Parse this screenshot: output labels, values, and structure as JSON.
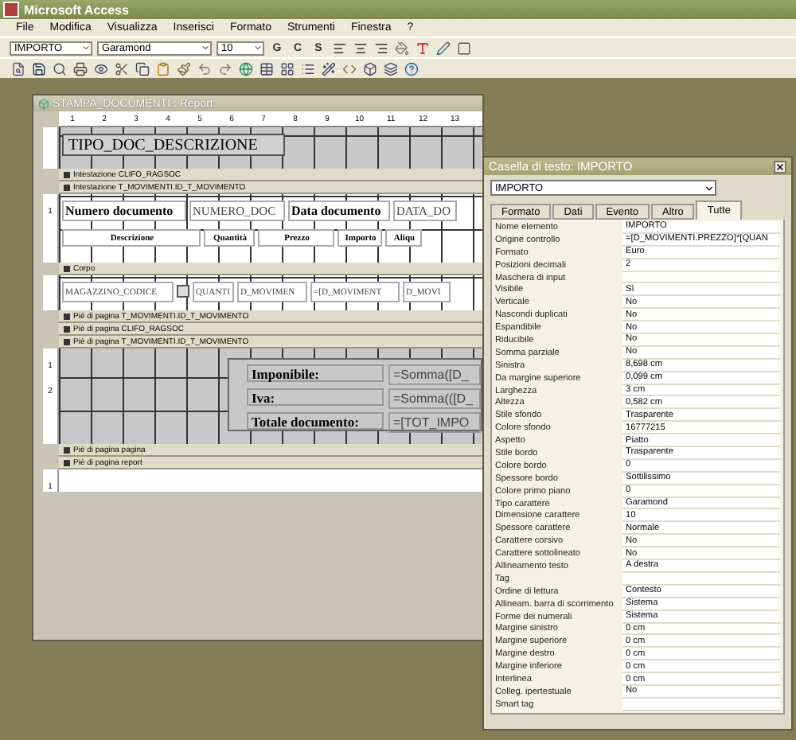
{
  "window": {
    "title": "Microsoft Access"
  },
  "menu": [
    "File",
    "Modifica",
    "Visualizza",
    "Inserisci",
    "Formato",
    "Strumenti",
    "Finestra",
    "?"
  ],
  "format_toolbar": {
    "object": "IMPORTO",
    "font": "Garamond",
    "size": "10",
    "style_buttons": [
      "G",
      "C",
      "S"
    ]
  },
  "report": {
    "title": "STAMPA_DOCUMENTI : Report",
    "ruler": [
      "1",
      "2",
      "3",
      "4",
      "5",
      "6",
      "7",
      "8",
      "9",
      "10",
      "11",
      "12",
      "13"
    ],
    "sections": [
      {
        "kind": "page_header",
        "title": "TIPO_DOC_DESCRIZIONE"
      },
      {
        "kind": "band",
        "label": "Intestazione CLIFO_RAGSOC"
      },
      {
        "kind": "band",
        "label": "Intestazione T_MOVIMENTI.ID_T_MOVIMENTO"
      },
      {
        "kind": "group_header",
        "v_ruler": [
          "1"
        ],
        "controls": [
          {
            "kind": "label",
            "text": "Numero documento"
          },
          {
            "kind": "field",
            "text": "NUMERO_DOC"
          },
          {
            "kind": "label",
            "text": "Data documento"
          },
          {
            "kind": "field",
            "text": "DATA_DO"
          }
        ],
        "captions": [
          "Descrizione",
          "Quantità",
          "Prezzo",
          "Importo",
          "Aliqu"
        ]
      },
      {
        "kind": "band",
        "label": "Corpo"
      },
      {
        "kind": "detail",
        "cells": [
          {
            "kind": "field",
            "text": "MAGAZZINO_CODICE"
          },
          {
            "kind": "combo"
          },
          {
            "kind": "field",
            "text": "QUANTI"
          },
          {
            "kind": "field",
            "text": "D_MOVIMEN"
          },
          {
            "kind": "field",
            "text": "=[D_MOVIMENT"
          },
          {
            "kind": "field",
            "text": "D_MOVI"
          }
        ]
      },
      {
        "kind": "band",
        "label": "Piè di pagina T_MOVIMENTI.ID_T_MOVIMENTO"
      },
      {
        "kind": "band",
        "label": "Piè di pagina CLIFO_RAGSOC"
      },
      {
        "kind": "band",
        "label": "Piè di pagina T_MOVIMENTI.ID_T_MOVIMENTO"
      },
      {
        "kind": "totals",
        "v_ruler": [
          "1",
          "2"
        ],
        "rows": [
          {
            "label": "Imponibile:",
            "value": "=Somma([D_"
          },
          {
            "label": "Iva:",
            "value": "=Somma(([D_"
          },
          {
            "label": "Totale documento:",
            "value": "=[TOT_IMPO"
          }
        ]
      },
      {
        "kind": "band",
        "label": "Piè di pagina pagina"
      },
      {
        "kind": "band",
        "label": "Piè di pagina report"
      },
      {
        "kind": "blank",
        "v_ruler": [
          "1"
        ]
      }
    ]
  },
  "sheet": {
    "title": "Casella di testo: IMPORTO",
    "object": "IMPORTO",
    "tabs": [
      {
        "label": "Formato",
        "selected": false
      },
      {
        "label": "Dati",
        "selected": false
      },
      {
        "label": "Evento",
        "selected": false
      },
      {
        "label": "Altro",
        "selected": false
      },
      {
        "label": "Tutte",
        "selected": true
      }
    ],
    "properties": [
      {
        "name": "Nome elemento",
        "value": "IMPORTO"
      },
      {
        "name": "Origine controllo",
        "value": "=[D_MOVIMENTI.PREZZO]*[QUAN"
      },
      {
        "name": "Formato",
        "value": "Euro"
      },
      {
        "name": "Posizioni decimali",
        "value": "2"
      },
      {
        "name": "Maschera di input"
      },
      {
        "name": "Visibile",
        "value": "Sì"
      },
      {
        "name": "Verticale",
        "value": "No"
      },
      {
        "name": "Nascondi duplicati",
        "value": "No"
      },
      {
        "name": "Espandibile",
        "value": "No"
      },
      {
        "name": "Riducibile",
        "value": "No"
      },
      {
        "name": "Somma parziale",
        "value": "No"
      },
      {
        "name": "Sinistra",
        "value": "8,698 cm"
      },
      {
        "name": "Da margine superiore",
        "value": "0,099 cm"
      },
      {
        "name": "Larghezza",
        "value": "3 cm"
      },
      {
        "name": "Altezza",
        "value": "0,582 cm"
      },
      {
        "name": "Stile sfondo",
        "value": "Trasparente"
      },
      {
        "name": "Colore sfondo",
        "value": "16777215"
      },
      {
        "name": "Aspetto",
        "value": "Piatto"
      },
      {
        "name": "Stile bordo",
        "value": "Trasparente"
      },
      {
        "name": "Colore bordo",
        "value": "0"
      },
      {
        "name": "Spessore bordo",
        "value": "Sottilissimo"
      },
      {
        "name": "Colore primo piano",
        "value": "0"
      },
      {
        "name": "Tipo carattere",
        "value": "Garamond"
      },
      {
        "name": "Dimensione carattere",
        "value": "10"
      },
      {
        "name": "Spessore carattere",
        "value": "Normale"
      },
      {
        "name": "Carattere corsivo",
        "value": "No"
      },
      {
        "name": "Carattere sottolineato",
        "value": "No"
      },
      {
        "name": "Allineamento testo",
        "value": "A destra"
      },
      {
        "name": "Tag"
      },
      {
        "name": "Ordine di lettura",
        "value": "Contesto"
      },
      {
        "name": "Allineam. barra di scorrimento",
        "value": "Sistema"
      },
      {
        "name": "Forme dei numerali",
        "value": "Sistema"
      },
      {
        "name": "Margine sinistro",
        "value": "0 cm"
      },
      {
        "name": "Margine superiore",
        "value": "0 cm"
      },
      {
        "name": "Margine destro",
        "value": "0 cm"
      },
      {
        "name": "Margine inferiore",
        "value": "0 cm"
      },
      {
        "name": "Interlinea",
        "value": "0 cm"
      },
      {
        "name": "Colleg. ipertestuale",
        "value": "No"
      },
      {
        "name": "Smart tag"
      }
    ]
  }
}
